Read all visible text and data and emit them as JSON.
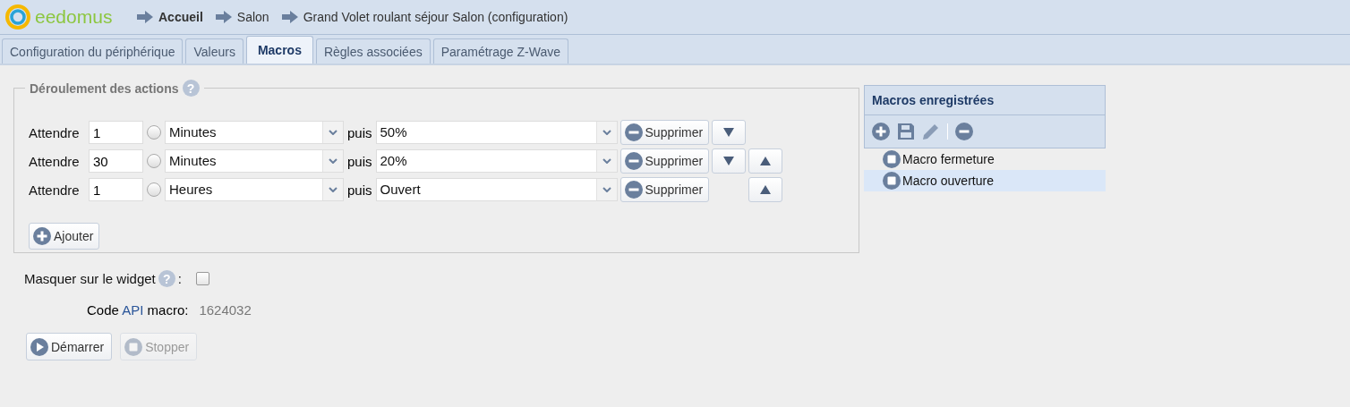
{
  "header": {
    "logo": "eedomus",
    "breadcrumbs": [
      {
        "label": "Accueil",
        "current": true
      },
      {
        "label": "Salon",
        "current": false
      },
      {
        "label": "Grand Volet roulant séjour Salon (configuration)",
        "current": false
      }
    ]
  },
  "tabs": [
    {
      "label": "Configuration du périphérique",
      "selected": false
    },
    {
      "label": "Valeurs",
      "selected": false
    },
    {
      "label": "Macros",
      "selected": true
    },
    {
      "label": "Règles associées",
      "selected": false
    },
    {
      "label": "Paramétrage Z-Wave",
      "selected": false
    }
  ],
  "actions": {
    "legend": "Déroulement des actions",
    "help": "?",
    "rows": [
      {
        "label": "Attendre",
        "delay": "1",
        "selected": false,
        "unit": "Minutes",
        "then": "puis",
        "action": "50%",
        "delete": "Supprimer",
        "move_down": true,
        "move_up": false
      },
      {
        "label": "Attendre",
        "delay": "30",
        "selected": false,
        "unit": "Minutes",
        "then": "puis",
        "action": "20%",
        "delete": "Supprimer",
        "move_down": true,
        "move_up": true
      },
      {
        "label": "Attendre",
        "delay": "1",
        "selected": false,
        "unit": "Heures",
        "then": "puis",
        "action": "Ouvert",
        "delete": "Supprimer",
        "move_down": false,
        "move_up": true
      }
    ],
    "add": "Ajouter"
  },
  "hide_widget": {
    "label": "Masquer sur le widget",
    "help": "?",
    "colon": ":",
    "checked": false
  },
  "api_code": {
    "before": "Code",
    "link": "API",
    "after": "macro:",
    "value": "1624032"
  },
  "buttons": [
    {
      "label": "Démarrer",
      "kind": "play",
      "disabled": false
    },
    {
      "label": "Stopper",
      "kind": "stop",
      "disabled": true
    }
  ],
  "saved_macros": {
    "title": "Macros enregistrées",
    "items": [
      {
        "label": "Macro fermeture",
        "selected": false
      },
      {
        "label": "Macro ouverture",
        "selected": true
      }
    ]
  }
}
